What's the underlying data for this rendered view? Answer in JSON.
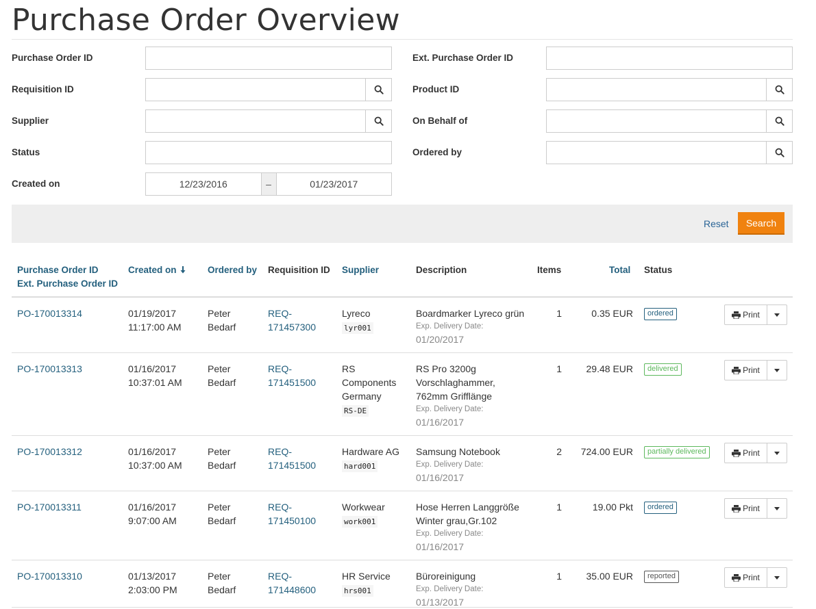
{
  "page": {
    "title": "Purchase Order Overview"
  },
  "filters": {
    "purchase_order_id": {
      "label": "Purchase Order ID",
      "value": ""
    },
    "ext_purchase_order_id": {
      "label": "Ext. Purchase Order ID",
      "value": ""
    },
    "requisition_id": {
      "label": "Requisition ID",
      "value": ""
    },
    "product_id": {
      "label": "Product ID",
      "value": ""
    },
    "supplier": {
      "label": "Supplier",
      "value": ""
    },
    "on_behalf_of": {
      "label": "On Behalf of",
      "value": ""
    },
    "status": {
      "label": "Status",
      "value": ""
    },
    "ordered_by": {
      "label": "Ordered by",
      "value": ""
    },
    "created_on": {
      "label": "Created on",
      "from": "12/23/2016",
      "separator": "–",
      "to": "01/23/2017"
    }
  },
  "actions": {
    "reset_label": "Reset",
    "search_label": "Search"
  },
  "table": {
    "headers": {
      "po_id": "Purchase Order ID",
      "ext_po_id": "Ext. Purchase Order ID",
      "created_on": "Created on",
      "ordered_by": "Ordered by",
      "requisition_id": "Requisition ID",
      "supplier": "Supplier",
      "description": "Description",
      "items": "Items",
      "total": "Total",
      "status": "Status"
    },
    "print_label": "Print",
    "exp_delivery_label": "Exp. Delivery Date:",
    "rows": [
      {
        "po_id": "PO-170013314",
        "created_date": "01/19/2017",
        "created_time": "11:17:00 AM",
        "ordered_by_first": "Peter",
        "ordered_by_last": "Bedarf",
        "req_line1": "REQ-",
        "req_line2": "171457300",
        "supplier_lines": [
          "Lyreco"
        ],
        "supplier_code": "lyr001",
        "description_lines": [
          "Boardmarker Lyreco grün"
        ],
        "exp_date": "01/20/2017",
        "items": "1",
        "total": "0.35 EUR",
        "status": "ordered"
      },
      {
        "po_id": "PO-170013313",
        "created_date": "01/16/2017",
        "created_time": "10:37:01 AM",
        "ordered_by_first": "Peter",
        "ordered_by_last": "Bedarf",
        "req_line1": "REQ-",
        "req_line2": "171451500",
        "supplier_lines": [
          "RS",
          "Components",
          "Germany"
        ],
        "supplier_code": "RS-DE",
        "description_lines": [
          "RS Pro 3200g",
          "Vorschlaghammer,",
          "762mm Grifflänge"
        ],
        "exp_date": "01/16/2017",
        "items": "1",
        "total": "29.48 EUR",
        "status": "delivered"
      },
      {
        "po_id": "PO-170013312",
        "created_date": "01/16/2017",
        "created_time": "10:37:00 AM",
        "ordered_by_first": "Peter",
        "ordered_by_last": "Bedarf",
        "req_line1": "REQ-",
        "req_line2": "171451500",
        "supplier_lines": [
          "Hardware AG"
        ],
        "supplier_code": "hard001",
        "description_lines": [
          "Samsung Notebook"
        ],
        "exp_date": "01/16/2017",
        "items": "2",
        "total": "724.00 EUR",
        "status": "partially delivered"
      },
      {
        "po_id": "PO-170013311",
        "created_date": "01/16/2017",
        "created_time": "9:07:00 AM",
        "ordered_by_first": "Peter",
        "ordered_by_last": "Bedarf",
        "req_line1": "REQ-",
        "req_line2": "171450100",
        "supplier_lines": [
          "Workwear"
        ],
        "supplier_code": "work001",
        "description_lines": [
          "Hose Herren Langgröße",
          "Winter grau,Gr.102"
        ],
        "exp_date": "01/16/2017",
        "items": "1",
        "total": "19.00 Pkt",
        "status": "ordered"
      },
      {
        "po_id": "PO-170013310",
        "created_date": "01/13/2017",
        "created_time": "2:03:00 PM",
        "ordered_by_first": "Peter",
        "ordered_by_last": "Bedarf",
        "req_line1": "REQ-",
        "req_line2": "171448600",
        "supplier_lines": [
          "HR Service"
        ],
        "supplier_code": "hrs001",
        "description_lines": [
          "Büroreinigung"
        ],
        "exp_date": "01/13/2017",
        "items": "1",
        "total": "35.00 EUR",
        "status": "reported"
      }
    ]
  },
  "colors": {
    "accent": "#f0820f",
    "link": "#235f7d",
    "status_ordered": "#235f7d",
    "status_delivered": "#5cb85c",
    "status_reported": "#555555"
  }
}
